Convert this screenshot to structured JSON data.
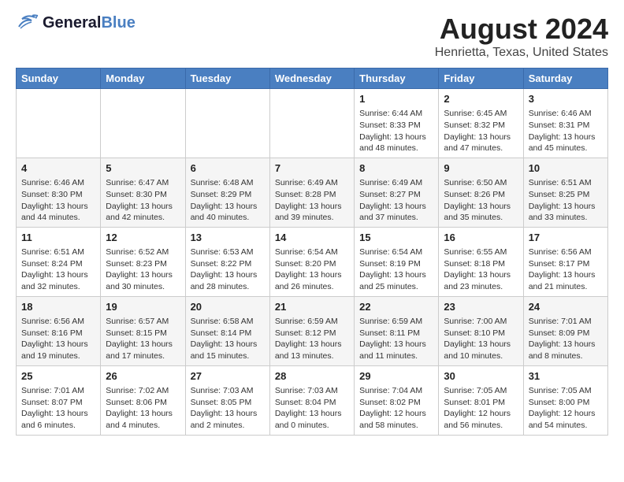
{
  "app": {
    "logo_general": "General",
    "logo_blue": "Blue",
    "title": "August 2024",
    "subtitle": "Henrietta, Texas, United States"
  },
  "calendar": {
    "headers": [
      "Sunday",
      "Monday",
      "Tuesday",
      "Wednesday",
      "Thursday",
      "Friday",
      "Saturday"
    ],
    "weeks": [
      [
        {
          "day": "",
          "info": ""
        },
        {
          "day": "",
          "info": ""
        },
        {
          "day": "",
          "info": ""
        },
        {
          "day": "",
          "info": ""
        },
        {
          "day": "1",
          "info": "Sunrise: 6:44 AM\nSunset: 8:33 PM\nDaylight: 13 hours and 48 minutes."
        },
        {
          "day": "2",
          "info": "Sunrise: 6:45 AM\nSunset: 8:32 PM\nDaylight: 13 hours and 47 minutes."
        },
        {
          "day": "3",
          "info": "Sunrise: 6:46 AM\nSunset: 8:31 PM\nDaylight: 13 hours and 45 minutes."
        }
      ],
      [
        {
          "day": "4",
          "info": "Sunrise: 6:46 AM\nSunset: 8:30 PM\nDaylight: 13 hours and 44 minutes."
        },
        {
          "day": "5",
          "info": "Sunrise: 6:47 AM\nSunset: 8:30 PM\nDaylight: 13 hours and 42 minutes."
        },
        {
          "day": "6",
          "info": "Sunrise: 6:48 AM\nSunset: 8:29 PM\nDaylight: 13 hours and 40 minutes."
        },
        {
          "day": "7",
          "info": "Sunrise: 6:49 AM\nSunset: 8:28 PM\nDaylight: 13 hours and 39 minutes."
        },
        {
          "day": "8",
          "info": "Sunrise: 6:49 AM\nSunset: 8:27 PM\nDaylight: 13 hours and 37 minutes."
        },
        {
          "day": "9",
          "info": "Sunrise: 6:50 AM\nSunset: 8:26 PM\nDaylight: 13 hours and 35 minutes."
        },
        {
          "day": "10",
          "info": "Sunrise: 6:51 AM\nSunset: 8:25 PM\nDaylight: 13 hours and 33 minutes."
        }
      ],
      [
        {
          "day": "11",
          "info": "Sunrise: 6:51 AM\nSunset: 8:24 PM\nDaylight: 13 hours and 32 minutes."
        },
        {
          "day": "12",
          "info": "Sunrise: 6:52 AM\nSunset: 8:23 PM\nDaylight: 13 hours and 30 minutes."
        },
        {
          "day": "13",
          "info": "Sunrise: 6:53 AM\nSunset: 8:22 PM\nDaylight: 13 hours and 28 minutes."
        },
        {
          "day": "14",
          "info": "Sunrise: 6:54 AM\nSunset: 8:20 PM\nDaylight: 13 hours and 26 minutes."
        },
        {
          "day": "15",
          "info": "Sunrise: 6:54 AM\nSunset: 8:19 PM\nDaylight: 13 hours and 25 minutes."
        },
        {
          "day": "16",
          "info": "Sunrise: 6:55 AM\nSunset: 8:18 PM\nDaylight: 13 hours and 23 minutes."
        },
        {
          "day": "17",
          "info": "Sunrise: 6:56 AM\nSunset: 8:17 PM\nDaylight: 13 hours and 21 minutes."
        }
      ],
      [
        {
          "day": "18",
          "info": "Sunrise: 6:56 AM\nSunset: 8:16 PM\nDaylight: 13 hours and 19 minutes."
        },
        {
          "day": "19",
          "info": "Sunrise: 6:57 AM\nSunset: 8:15 PM\nDaylight: 13 hours and 17 minutes."
        },
        {
          "day": "20",
          "info": "Sunrise: 6:58 AM\nSunset: 8:14 PM\nDaylight: 13 hours and 15 minutes."
        },
        {
          "day": "21",
          "info": "Sunrise: 6:59 AM\nSunset: 8:12 PM\nDaylight: 13 hours and 13 minutes."
        },
        {
          "day": "22",
          "info": "Sunrise: 6:59 AM\nSunset: 8:11 PM\nDaylight: 13 hours and 11 minutes."
        },
        {
          "day": "23",
          "info": "Sunrise: 7:00 AM\nSunset: 8:10 PM\nDaylight: 13 hours and 10 minutes."
        },
        {
          "day": "24",
          "info": "Sunrise: 7:01 AM\nSunset: 8:09 PM\nDaylight: 13 hours and 8 minutes."
        }
      ],
      [
        {
          "day": "25",
          "info": "Sunrise: 7:01 AM\nSunset: 8:07 PM\nDaylight: 13 hours and 6 minutes."
        },
        {
          "day": "26",
          "info": "Sunrise: 7:02 AM\nSunset: 8:06 PM\nDaylight: 13 hours and 4 minutes."
        },
        {
          "day": "27",
          "info": "Sunrise: 7:03 AM\nSunset: 8:05 PM\nDaylight: 13 hours and 2 minutes."
        },
        {
          "day": "28",
          "info": "Sunrise: 7:03 AM\nSunset: 8:04 PM\nDaylight: 13 hours and 0 minutes."
        },
        {
          "day": "29",
          "info": "Sunrise: 7:04 AM\nSunset: 8:02 PM\nDaylight: 12 hours and 58 minutes."
        },
        {
          "day": "30",
          "info": "Sunrise: 7:05 AM\nSunset: 8:01 PM\nDaylight: 12 hours and 56 minutes."
        },
        {
          "day": "31",
          "info": "Sunrise: 7:05 AM\nSunset: 8:00 PM\nDaylight: 12 hours and 54 minutes."
        }
      ]
    ]
  }
}
